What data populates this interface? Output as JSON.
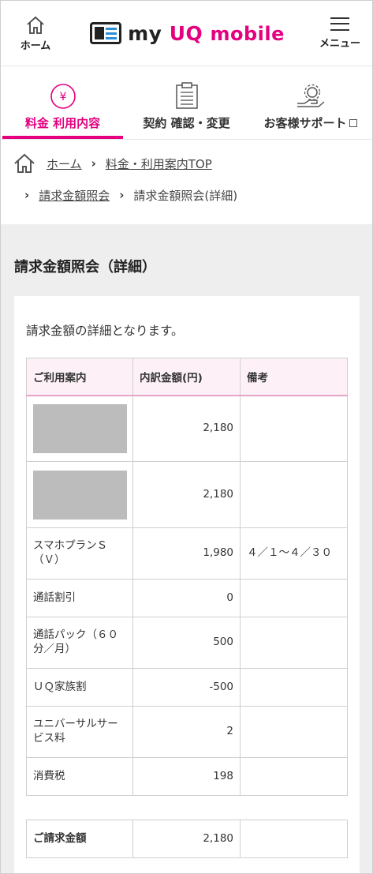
{
  "header": {
    "home_label": "ホーム",
    "logo_my": "my",
    "logo_uq": "UQ",
    "logo_mobile": "mobile",
    "menu_label": "メニュー"
  },
  "tabs": [
    {
      "label": "料金 利用内容",
      "icon": "yen-icon",
      "active": true
    },
    {
      "label": "契約 確認・変更",
      "icon": "clipboard-icon",
      "active": false
    },
    {
      "label": "お客様サポート",
      "icon": "support-gear-icon",
      "active": false
    }
  ],
  "breadcrumb": {
    "home": "ホーム",
    "top": "料金・利用案内TOP",
    "billing": "請求金額照会",
    "current": "請求金額照会(詳細)"
  },
  "page": {
    "title": "請求金額照会（詳細）",
    "intro": "請求金額の詳細となります。"
  },
  "table": {
    "headers": [
      "ご利用案内",
      "内訳金額(円)",
      "備考"
    ],
    "rows": [
      {
        "item": "",
        "amount": "2,180",
        "note": "",
        "redacted": true
      },
      {
        "item": "",
        "amount": "2,180",
        "note": "",
        "redacted": true
      },
      {
        "item": "スマホプランＳ（Ｖ）",
        "amount": "1,980",
        "note": "４／１～４／３０"
      },
      {
        "item": "通話割引",
        "amount": "0",
        "note": ""
      },
      {
        "item": "通話パック（６０分／月）",
        "amount": "500",
        "note": ""
      },
      {
        "item": "ＵＱ家族割",
        "amount": "-500",
        "note": ""
      },
      {
        "item": "ユニバーサルサービス料",
        "amount": "2",
        "note": ""
      },
      {
        "item": "消費税",
        "amount": "198",
        "note": ""
      }
    ],
    "total": {
      "label": "ご請求金額",
      "amount": "2,180",
      "note": ""
    }
  },
  "colors": {
    "accent": "#e4007f",
    "header_bg": "#fdf1f7",
    "page_bg": "#eeeeee"
  }
}
